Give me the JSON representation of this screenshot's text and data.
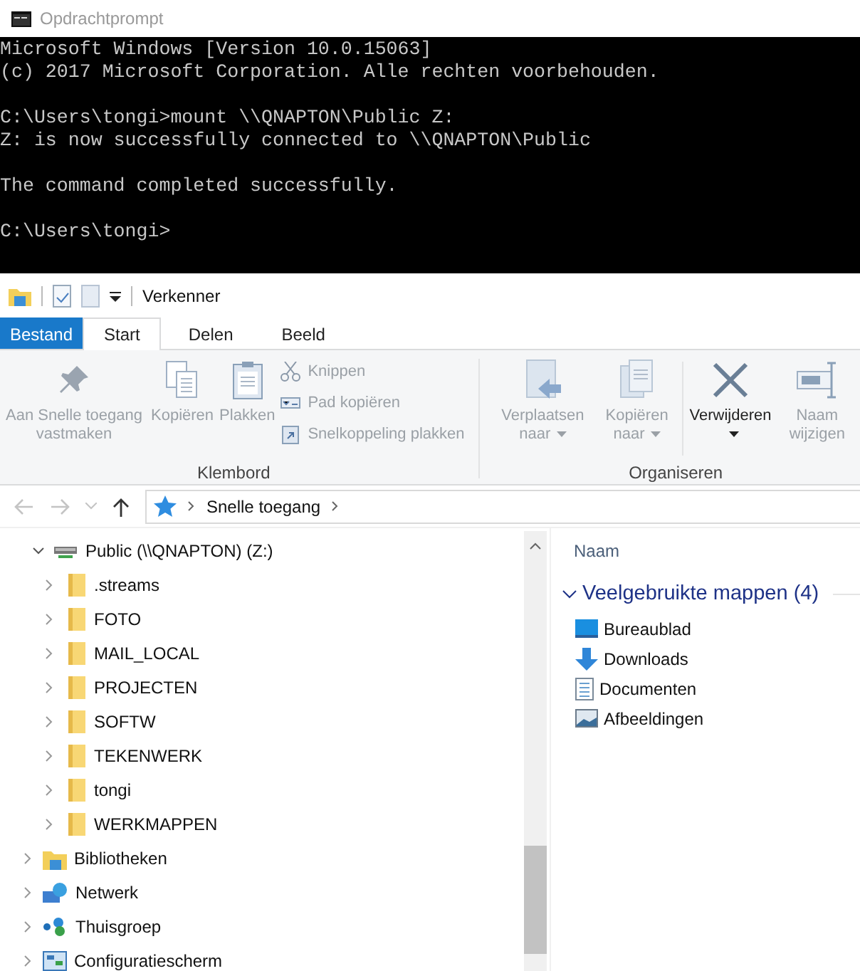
{
  "console": {
    "title": "Opdrachtprompt",
    "blocks": [
      [
        "Microsoft Windows [Version 10.0.15063]",
        "(c) 2017 Microsoft Corporation. Alle rechten voorbehouden."
      ],
      [
        "C:\\Users\\tongi>mount \\\\QNAPTON\\Public Z:",
        "Z: is now successfully connected to \\\\QNAPTON\\Public"
      ],
      [
        "The command completed successfully."
      ],
      [
        "C:\\Users\\tongi>"
      ]
    ]
  },
  "explorer": {
    "title": "Verkenner",
    "tabs": [
      {
        "label": "Bestand",
        "kind": "file",
        "selected": false
      },
      {
        "label": "Start",
        "kind": "tab",
        "selected": true
      },
      {
        "label": "Delen",
        "kind": "tab",
        "selected": false
      },
      {
        "label": "Beeld",
        "kind": "tab",
        "selected": false
      }
    ],
    "ribbon": [
      {
        "label": "Klembord",
        "buttons": [
          {
            "label": "Aan Snelle toegang vastmaken",
            "kind": "large",
            "disabled": true,
            "dropdown": false
          },
          {
            "label": "Kopiëren",
            "kind": "large",
            "disabled": true,
            "dropdown": false
          },
          {
            "label": "Plakken",
            "kind": "large",
            "disabled": true,
            "dropdown": false
          },
          {
            "label": "Knippen",
            "kind": "small",
            "disabled": true,
            "dropdown": false
          },
          {
            "label": "Pad kopiëren",
            "kind": "small",
            "disabled": true,
            "dropdown": false
          },
          {
            "label": "Snelkoppeling plakken",
            "kind": "small",
            "disabled": true,
            "dropdown": false
          }
        ]
      },
      {
        "label": "Organiseren",
        "buttons": [
          {
            "label": "Verplaatsen naar",
            "kind": "large",
            "disabled": true,
            "dropdown": true
          },
          {
            "label": "Kopiëren naar",
            "kind": "large",
            "disabled": true,
            "dropdown": true
          },
          {
            "label": "Verwijderen",
            "kind": "large",
            "disabled": false,
            "dropdown": true
          },
          {
            "label": "Naam wijzigen",
            "kind": "large",
            "disabled": true,
            "dropdown": false
          }
        ]
      }
    ],
    "address": {
      "crumbs": [
        "Snelle toegang"
      ]
    },
    "tree": [
      {
        "label": "Public (\\\\QNAPTON) (Z:)",
        "kind": "drive",
        "expanded": true,
        "children": [
          {
            "label": ".streams",
            "kind": "folder",
            "expanded": false
          },
          {
            "label": "FOTO",
            "kind": "folder",
            "expanded": false
          },
          {
            "label": "MAIL_LOCAL",
            "kind": "folder",
            "expanded": false
          },
          {
            "label": "PROJECTEN",
            "kind": "folder",
            "expanded": false
          },
          {
            "label": "SOFTW",
            "kind": "folder",
            "expanded": false
          },
          {
            "label": "TEKENWERK",
            "kind": "folder",
            "expanded": false
          },
          {
            "label": "tongi",
            "kind": "folder",
            "expanded": false
          },
          {
            "label": "WERKMAPPEN",
            "kind": "folder",
            "expanded": false
          }
        ]
      },
      {
        "label": "Bibliotheken",
        "kind": "library",
        "expanded": false
      },
      {
        "label": "Netwerk",
        "kind": "network",
        "expanded": false
      },
      {
        "label": "Thuisgroep",
        "kind": "homegroup",
        "expanded": false
      },
      {
        "label": "Configuratiescherm",
        "kind": "control-panel",
        "expanded": false
      }
    ],
    "column_header": "Naam",
    "group": {
      "label": "Veelgebruikte mappen (4)",
      "expanded": true,
      "items": [
        {
          "label": "Bureaublad",
          "kind": "desktop"
        },
        {
          "label": "Downloads",
          "kind": "downloads"
        },
        {
          "label": "Documenten",
          "kind": "documents"
        },
        {
          "label": "Afbeeldingen",
          "kind": "pictures"
        }
      ]
    }
  }
}
